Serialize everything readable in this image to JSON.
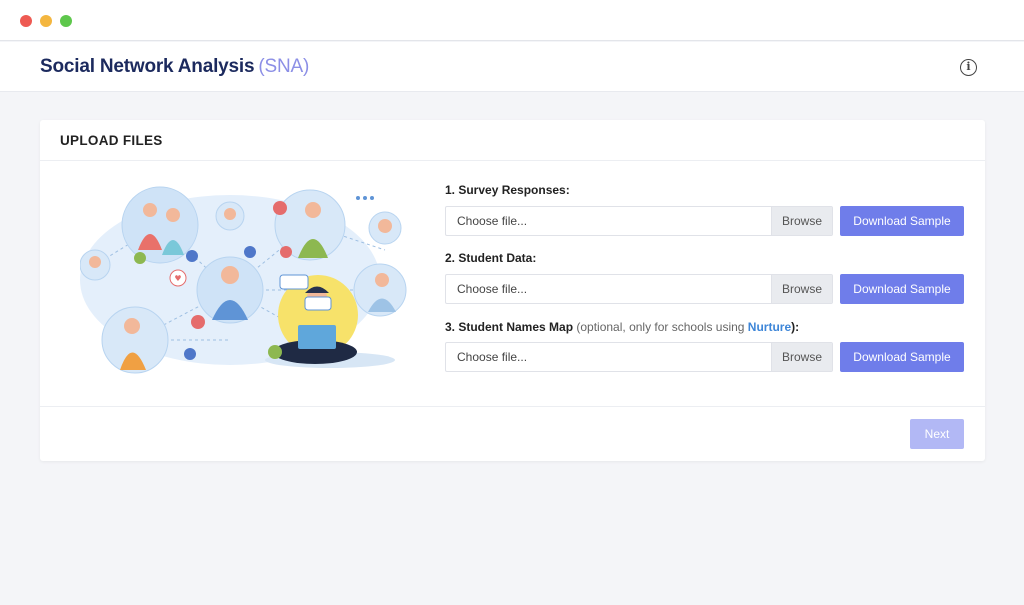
{
  "app": {
    "title": "Social Network Analysis",
    "title_abbr": "(SNA)",
    "info_icon_glyph": "i"
  },
  "upload": {
    "heading": "UPLOAD FILES",
    "fields": [
      {
        "label": "1. Survey Responses:",
        "placeholder": "Choose file...",
        "browse_label": "Browse",
        "download_label": "Download Sample"
      },
      {
        "label": "2. Student Data:",
        "placeholder": "Choose file...",
        "browse_label": "Browse",
        "download_label": "Download Sample"
      },
      {
        "label": "3. Student Names Map",
        "label_optional": " (optional, only for schools using ",
        "label_link": "Nurture",
        "label_end": "):",
        "placeholder": "Choose file...",
        "browse_label": "Browse",
        "download_label": "Download Sample"
      }
    ],
    "next_label": "Next"
  },
  "colors": {
    "brand_navy": "#1c2a5e",
    "accent": "#6f7dea",
    "accent_disabled": "#b2b8f5",
    "link": "#3e86d8"
  },
  "icons": {
    "window_controls": [
      "close-dot",
      "minimize-dot",
      "zoom-dot"
    ],
    "info": "info-icon"
  }
}
